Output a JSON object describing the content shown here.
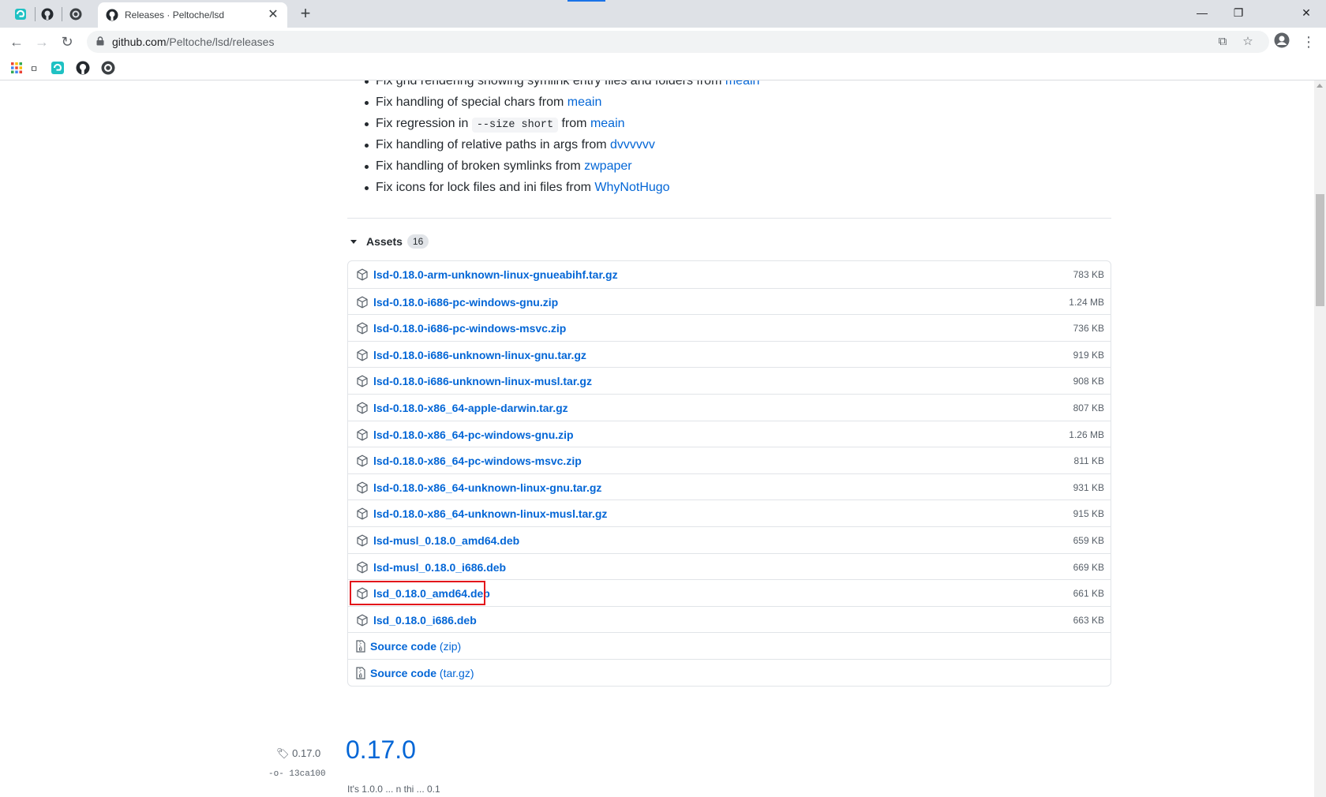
{
  "browser": {
    "tab_title": "Releases · Peltoche/lsd",
    "url_host": "github.com",
    "url_path": "/Peltoche/lsd/releases"
  },
  "release_notes": [
    {
      "text": "Fix grid rendering showing symlink entry files and folders from ",
      "code": "",
      "after": "",
      "link": "meain"
    },
    {
      "text": "Fix handling of special chars from ",
      "code": "",
      "after": "",
      "link": "meain"
    },
    {
      "text": "Fix regression in ",
      "code": "--size short",
      "after": " from ",
      "link": "meain"
    },
    {
      "text": "Fix handling of relative paths in args from ",
      "code": "",
      "after": "",
      "link": "dvvvvvv"
    },
    {
      "text": "Fix handling of broken symlinks from ",
      "code": "",
      "after": "",
      "link": "zwpaper"
    },
    {
      "text": "Fix icons for lock files and ini files from ",
      "code": "",
      "after": "",
      "link": "WhyNotHugo"
    }
  ],
  "assets": {
    "label": "Assets",
    "count": "16",
    "files": [
      {
        "name": "lsd-0.18.0-arm-unknown-linux-gnueabihf.tar.gz",
        "size": "783 KB"
      },
      {
        "name": "lsd-0.18.0-i686-pc-windows-gnu.zip",
        "size": "1.24 MB"
      },
      {
        "name": "lsd-0.18.0-i686-pc-windows-msvc.zip",
        "size": "736 KB"
      },
      {
        "name": "lsd-0.18.0-i686-unknown-linux-gnu.tar.gz",
        "size": "919 KB"
      },
      {
        "name": "lsd-0.18.0-i686-unknown-linux-musl.tar.gz",
        "size": "908 KB"
      },
      {
        "name": "lsd-0.18.0-x86_64-apple-darwin.tar.gz",
        "size": "807 KB"
      },
      {
        "name": "lsd-0.18.0-x86_64-pc-windows-gnu.zip",
        "size": "1.26 MB"
      },
      {
        "name": "lsd-0.18.0-x86_64-pc-windows-msvc.zip",
        "size": "811 KB"
      },
      {
        "name": "lsd-0.18.0-x86_64-unknown-linux-gnu.tar.gz",
        "size": "931 KB"
      },
      {
        "name": "lsd-0.18.0-x86_64-unknown-linux-musl.tar.gz",
        "size": "915 KB"
      },
      {
        "name": "lsd-musl_0.18.0_amd64.deb",
        "size": "659 KB"
      },
      {
        "name": "lsd-musl_0.18.0_i686.deb",
        "size": "669 KB"
      },
      {
        "name": "lsd_0.18.0_amd64.deb",
        "size": "661 KB"
      },
      {
        "name": "lsd_0.18.0_i686.deb",
        "size": "663 KB"
      }
    ],
    "source": [
      {
        "label": "Source code",
        "format": "(zip)"
      },
      {
        "label": "Source code",
        "format": "(tar.gz)"
      }
    ]
  },
  "next_release": {
    "tag": "0.17.0",
    "commit": "13ca100",
    "title": "0.17.0",
    "partial_text": "It's 1.0.0 ... n thi ... 0.1"
  }
}
